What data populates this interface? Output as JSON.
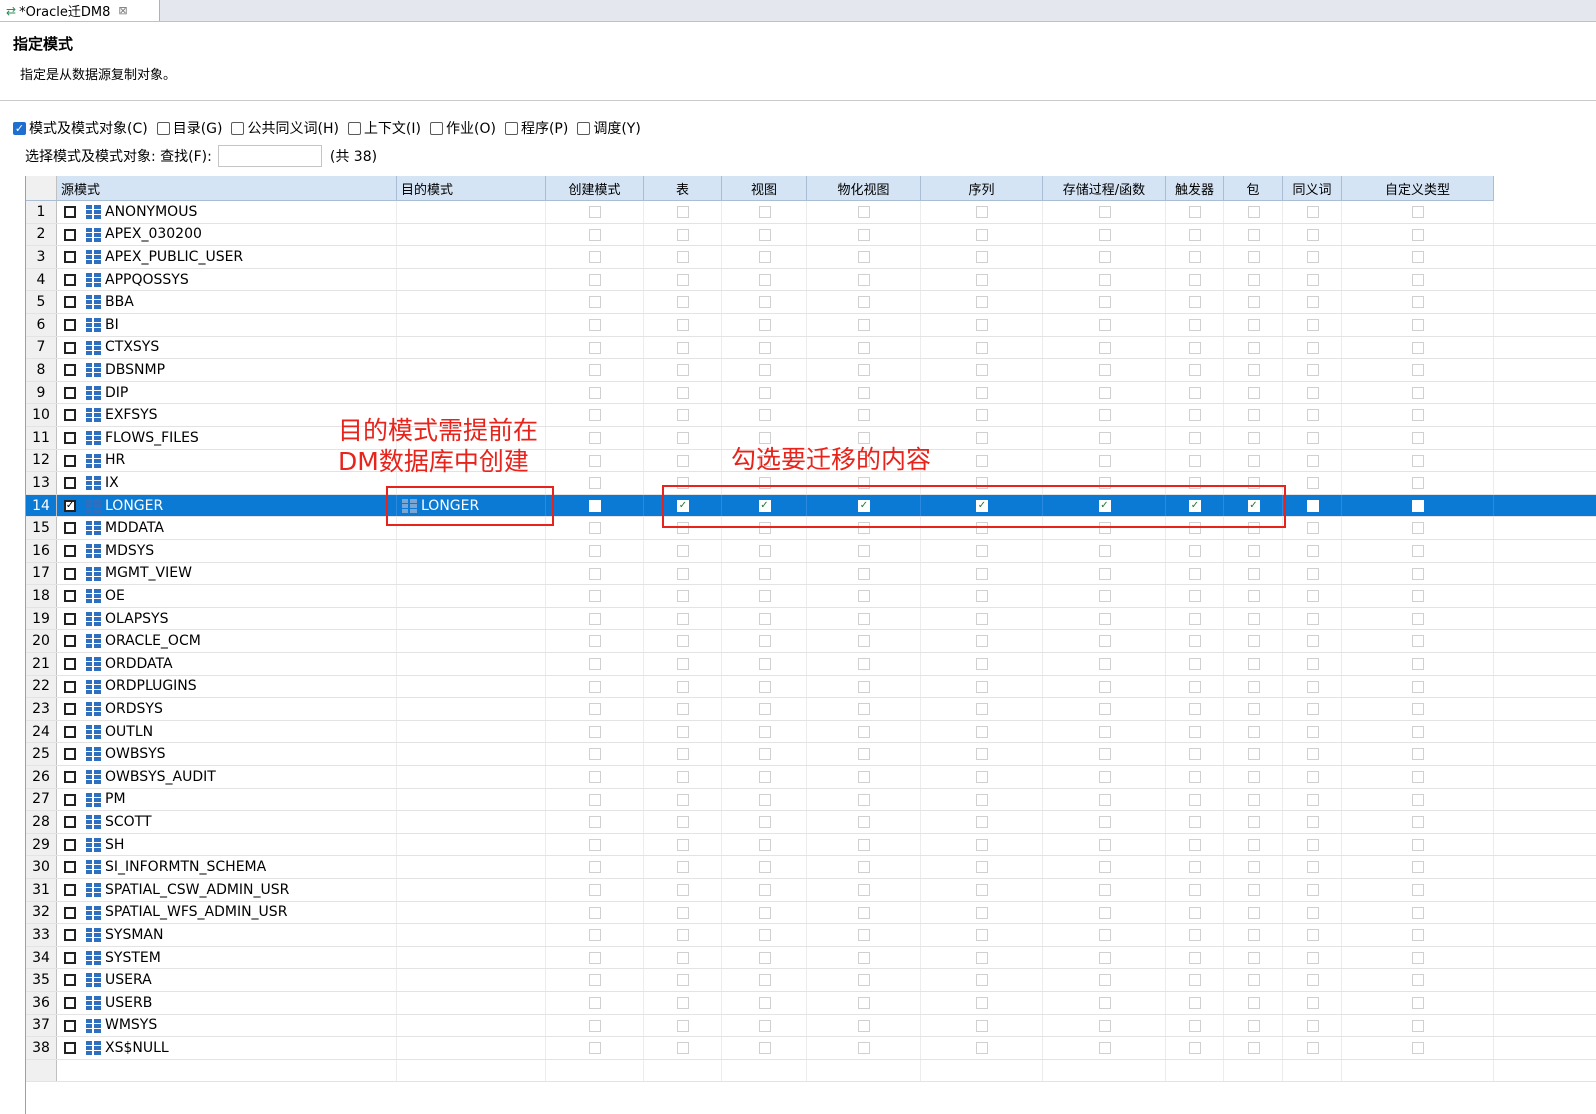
{
  "tab": {
    "title": "*Oracle迁DM8",
    "close": "⊠"
  },
  "header": {
    "title": "指定模式",
    "description": "指定是从数据源复制对象。"
  },
  "options": [
    {
      "label": "模式及模式对象(C)",
      "checked": true
    },
    {
      "label": "目录(G)",
      "checked": false
    },
    {
      "label": "公共同义词(H)",
      "checked": false
    },
    {
      "label": "上下文(I)",
      "checked": false
    },
    {
      "label": "作业(O)",
      "checked": false
    },
    {
      "label": "程序(P)",
      "checked": false
    },
    {
      "label": "调度(Y)",
      "checked": false
    }
  ],
  "search": {
    "label": "选择模式及模式对象: 查找(F):",
    "value": "",
    "count_text": "(共 38)"
  },
  "columns": [
    "源模式",
    "目的模式",
    "创建模式",
    "表",
    "视图",
    "物化视图",
    "序列",
    "存储过程/函数",
    "触发器",
    "包",
    "同义词",
    "自定义类型"
  ],
  "rows": [
    {
      "num": "1",
      "source": "ANONYMOUS"
    },
    {
      "num": "2",
      "source": "APEX_030200"
    },
    {
      "num": "3",
      "source": "APEX_PUBLIC_USER"
    },
    {
      "num": "4",
      "source": "APPQOSSYS"
    },
    {
      "num": "5",
      "source": "BBA"
    },
    {
      "num": "6",
      "source": "BI"
    },
    {
      "num": "7",
      "source": "CTXSYS"
    },
    {
      "num": "8",
      "source": "DBSNMP"
    },
    {
      "num": "9",
      "source": "DIP"
    },
    {
      "num": "10",
      "source": "EXFSYS"
    },
    {
      "num": "11",
      "source": "FLOWS_FILES"
    },
    {
      "num": "12",
      "source": "HR"
    },
    {
      "num": "13",
      "source": "IX"
    },
    {
      "num": "14",
      "source": "LONGER",
      "target": "LONGER",
      "selected": true,
      "checked": true,
      "flags": [
        false,
        true,
        true,
        true,
        true,
        true,
        true,
        true,
        false,
        false
      ]
    },
    {
      "num": "15",
      "source": "MDDATA"
    },
    {
      "num": "16",
      "source": "MDSYS"
    },
    {
      "num": "17",
      "source": "MGMT_VIEW"
    },
    {
      "num": "18",
      "source": "OE"
    },
    {
      "num": "19",
      "source": "OLAPSYS"
    },
    {
      "num": "20",
      "source": "ORACLE_OCM"
    },
    {
      "num": "21",
      "source": "ORDDATA"
    },
    {
      "num": "22",
      "source": "ORDPLUGINS"
    },
    {
      "num": "23",
      "source": "ORDSYS"
    },
    {
      "num": "24",
      "source": "OUTLN"
    },
    {
      "num": "25",
      "source": "OWBSYS"
    },
    {
      "num": "26",
      "source": "OWBSYS_AUDIT"
    },
    {
      "num": "27",
      "source": "PM"
    },
    {
      "num": "28",
      "source": "SCOTT"
    },
    {
      "num": "29",
      "source": "SH"
    },
    {
      "num": "30",
      "source": "SI_INFORMTN_SCHEMA"
    },
    {
      "num": "31",
      "source": "SPATIAL_CSW_ADMIN_USR"
    },
    {
      "num": "32",
      "source": "SPATIAL_WFS_ADMIN_USR"
    },
    {
      "num": "33",
      "source": "SYSMAN"
    },
    {
      "num": "34",
      "source": "SYSTEM"
    },
    {
      "num": "35",
      "source": "USERA"
    },
    {
      "num": "36",
      "source": "USERB"
    },
    {
      "num": "37",
      "source": "WMSYS"
    },
    {
      "num": "38",
      "source": "XS$NULL"
    }
  ],
  "annotations": {
    "target_note": [
      "目的模式需提前在",
      "DM数据库中创建"
    ],
    "select_note": "勾选要迁移的内容",
    "color": "#e8231b"
  },
  "colors": {
    "selection": "#0a7ad5",
    "header": "#d5e4f5",
    "accent": "#1f6fd0"
  }
}
